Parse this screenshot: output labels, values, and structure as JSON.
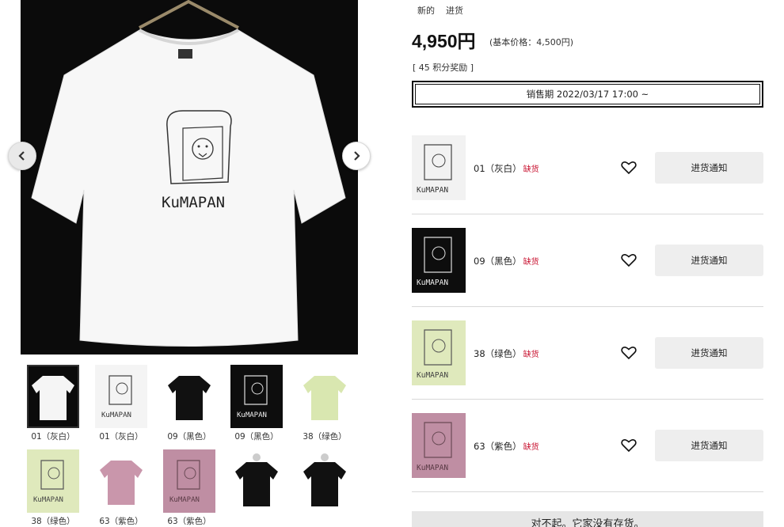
{
  "product": {
    "tags": [
      "新的",
      "进货"
    ],
    "price": "4,950円",
    "base_price": "(基本价格：4,500円)",
    "points": "[ 45 积分奖励 ]",
    "sale_period": "销售期 2022/03/17 17:00 ~",
    "shirt_print": "KuMAPAN"
  },
  "thumbnails": [
    {
      "label": "01（灰白）",
      "style": "black-bg-white-shirt"
    },
    {
      "label": "01（灰白）",
      "style": "white-print"
    },
    {
      "label": "09（黑色）",
      "style": "black-shirt-hanger"
    },
    {
      "label": "09（黑色）",
      "style": "black-print"
    },
    {
      "label": "38（绿色）",
      "style": "green-shirt-hanger"
    },
    {
      "label": "38（绿色）",
      "style": "green-print"
    },
    {
      "label": "63（紫色）",
      "style": "pink-shirt-hanger"
    },
    {
      "label": "63（紫色）",
      "style": "pink-print"
    },
    {
      "label": "",
      "style": "black-shirt-model-front"
    },
    {
      "label": "",
      "style": "black-shirt-model-back"
    }
  ],
  "variants": [
    {
      "name": "01（灰白）",
      "status": "缺货",
      "notify_label": "进货通知",
      "color": "#f2f2f2"
    },
    {
      "name": "09（黑色）",
      "status": "缺货",
      "notify_label": "进货通知",
      "color": "#0d0d0d"
    },
    {
      "name": "38（绿色）",
      "status": "缺货",
      "notify_label": "进货通知",
      "color": "#dfe9bc"
    },
    {
      "name": "63（紫色）",
      "status": "缺货",
      "notify_label": "进货通知",
      "color": "#bf8ea3"
    }
  ],
  "sorry_message": "对不起。它家没有存货。",
  "icons": {
    "prev": "chevron-left-icon",
    "next": "chevron-right-icon",
    "favorite": "heart-icon"
  }
}
